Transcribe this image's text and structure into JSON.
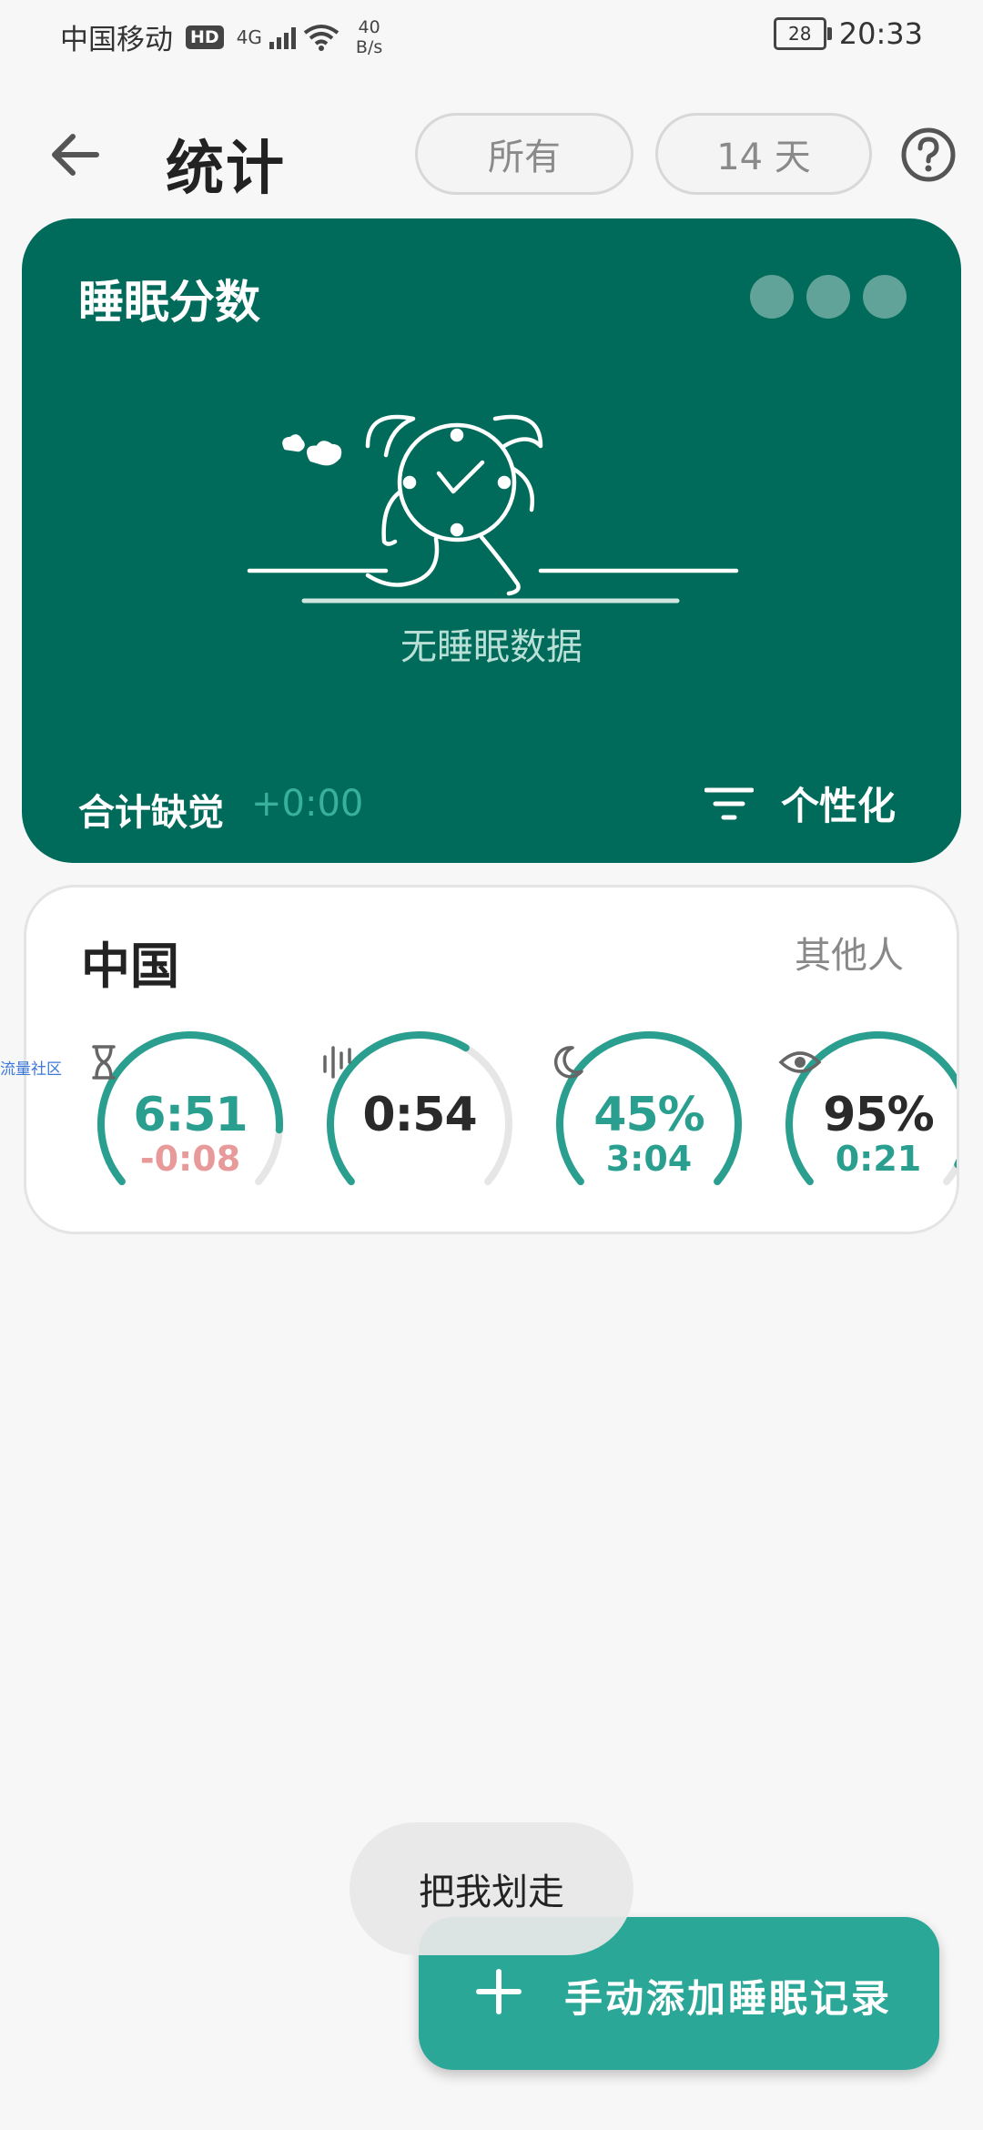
{
  "status_bar": {
    "carrier": "中国移动",
    "hd_badge": "HD",
    "signal_type": "4G",
    "net_speed_value": "40",
    "net_speed_unit": "B/s",
    "battery": "28",
    "time": "20:33"
  },
  "header": {
    "title": "统计",
    "filter_all": "所有",
    "filter_days": "14 天"
  },
  "score_card": {
    "title": "睡眠分数",
    "empty_message": "无睡眠数据",
    "deficit_label": "合计缺觉",
    "deficit_value": "+0:00",
    "personalize_label": "个性化",
    "background_color": "#006b5a"
  },
  "stats_card": {
    "region": "中国",
    "others_link": "其他人",
    "gauges": [
      {
        "icon": "hourglass-icon",
        "value": "6:51",
        "sub": "-0:08",
        "fill": 0.86
      },
      {
        "icon": "sound-wave-icon",
        "value": "0:54",
        "sub": "",
        "fill": 0.62
      },
      {
        "icon": "moon-icon",
        "value": "45%",
        "sub": "3:04",
        "fill": 1.0
      },
      {
        "icon": "eye-icon",
        "value": "95%",
        "sub": "0:21",
        "fill": 0.95
      }
    ]
  },
  "watermark": "流量社区",
  "swipe_hint": "把我划走",
  "fab": {
    "label": "手动添加睡眠记录",
    "color": "#2aa797"
  }
}
